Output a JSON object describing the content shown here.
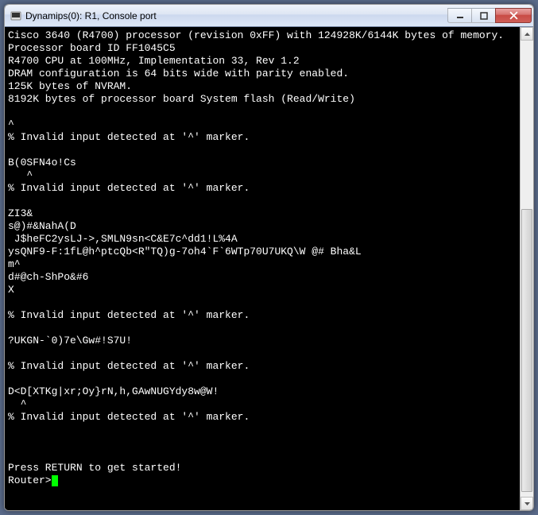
{
  "window": {
    "title": "Dynamips(0): R1, Console port"
  },
  "console": {
    "lines": [
      "Cisco 3640 (R4700) processor (revision 0xFF) with 124928K/6144K bytes of memory.",
      "Processor board ID FF1045C5",
      "R4700 CPU at 100MHz, Implementation 33, Rev 1.2",
      "DRAM configuration is 64 bits wide with parity enabled.",
      "125K bytes of NVRAM.",
      "8192K bytes of processor board System flash (Read/Write)",
      "",
      "^",
      "% Invalid input detected at '^' marker.",
      "",
      "B(0SFN4o!Cs",
      "   ^",
      "% Invalid input detected at '^' marker.",
      "",
      "ZI3&",
      "s@)#&NahA(D",
      " J$heFC2ysLJ->,SMLN9sn<C&E7c^dd1!L%4A",
      "ysQNF9-F:1fL@h^ptcQb<R\"TQ)g-7oh4`F`6WTp70U7UKQ\\W @# Bha&L",
      "m^",
      "d#@ch-ShPo&#6",
      "X",
      "",
      "% Invalid input detected at '^' marker.",
      "",
      "?UKGN-`0)7e\\Gw#!S7U!",
      "",
      "% Invalid input detected at '^' marker.",
      "",
      "D<D[XTKg|xr;Oy}rN,h,GAwNUGYdy8w@W!",
      "  ^",
      "% Invalid input detected at '^' marker.",
      "",
      "",
      "",
      "Press RETURN to get started!",
      ""
    ],
    "prompt": "Router>"
  }
}
